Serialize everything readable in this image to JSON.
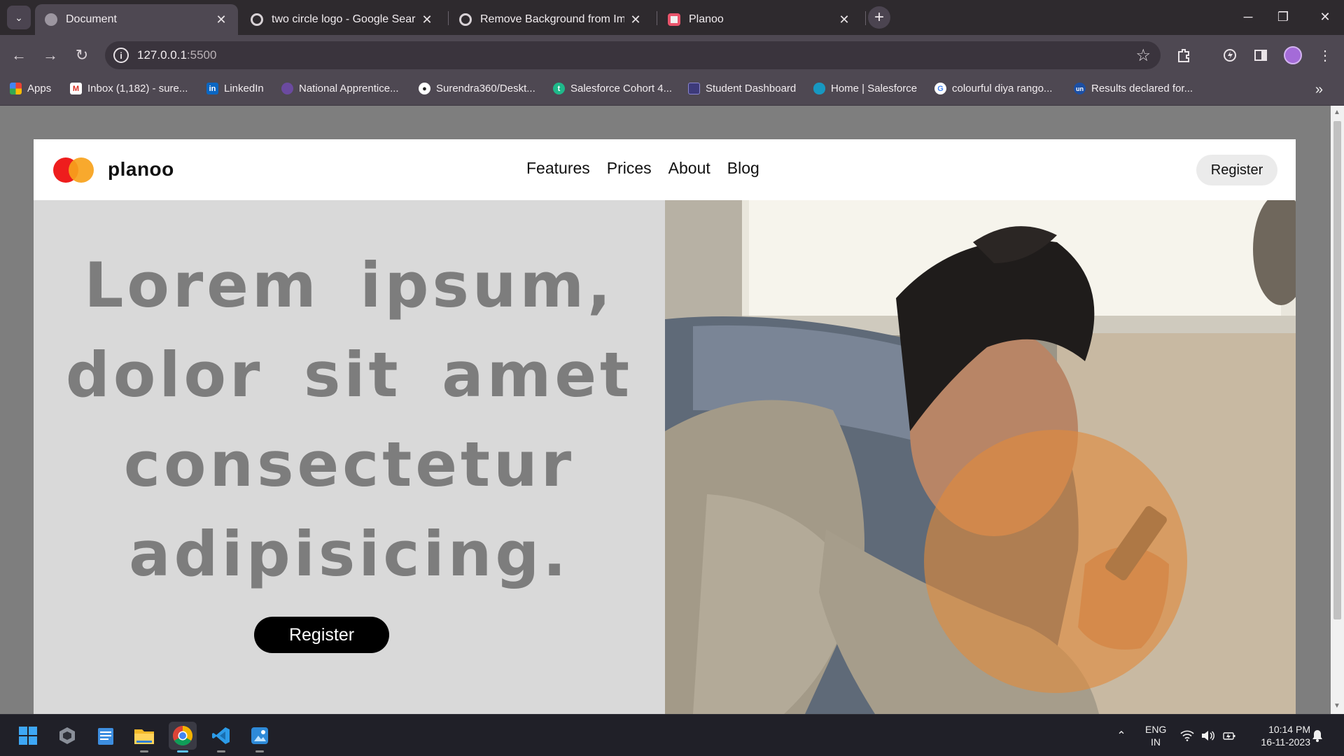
{
  "browser": {
    "tabs": [
      {
        "title": "Document",
        "active": true
      },
      {
        "title": "two circle logo - Google Search",
        "active": false
      },
      {
        "title": "Remove Background from Imag",
        "active": false
      },
      {
        "title": "Planoo",
        "active": false
      }
    ],
    "url_host": "127.0.0.1",
    "url_port": ":5500",
    "bookmarks": [
      {
        "label": "Apps",
        "icon": "apps-grid-icon"
      },
      {
        "label": "Inbox (1,182) - sure...",
        "icon": "gmail-icon"
      },
      {
        "label": "LinkedIn",
        "icon": "linkedin-icon"
      },
      {
        "label": "National Apprentice...",
        "icon": "apprentice-icon"
      },
      {
        "label": "Surendra360/Deskt...",
        "icon": "github-icon"
      },
      {
        "label": "Salesforce Cohort 4...",
        "icon": "trailhead-icon"
      },
      {
        "label": "Student Dashboard",
        "icon": "dashboard-icon"
      },
      {
        "label": "Home | Salesforce",
        "icon": "salesforce-cloud-icon"
      },
      {
        "label": "colourful diya rango...",
        "icon": "google-icon"
      },
      {
        "label": "Results declared for...",
        "icon": "unstop-icon"
      }
    ]
  },
  "site": {
    "brand": "planoo",
    "menu": [
      "Features",
      "Prices",
      "About",
      "Blog"
    ],
    "nav_register": "Register",
    "headline": "Lorem ipsum, dolor sit amet consectetur adipisicing.",
    "hero_register": "Register",
    "colors": {
      "logo_red": "#ee1d1d",
      "logo_orange": "#f7a21b",
      "headline": "#7d7d7d",
      "hero_bg": "#d9d9d9"
    }
  },
  "taskbar": {
    "apps": [
      "windows-start-icon",
      "app-cube-icon",
      "notepad-icon",
      "file-explorer-icon",
      "chrome-icon",
      "vscode-icon",
      "paint-icon"
    ],
    "lang_line1": "ENG",
    "lang_line2": "IN",
    "time": "10:14 PM",
    "date": "16-11-2023"
  }
}
